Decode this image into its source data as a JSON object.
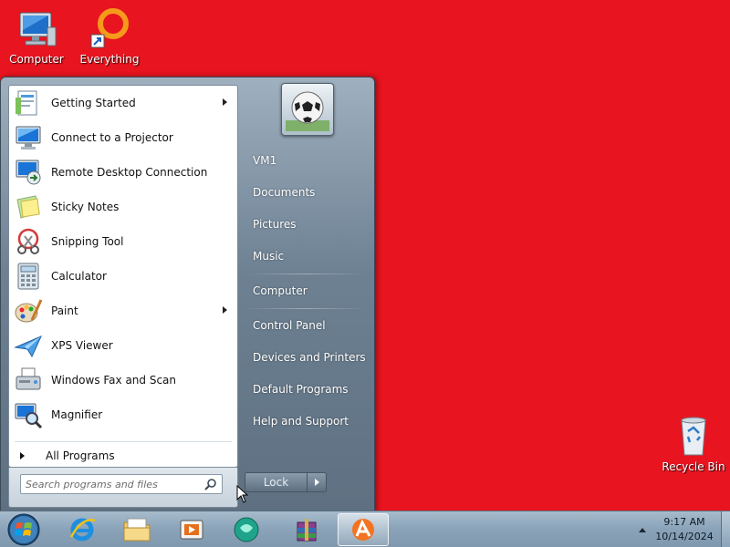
{
  "desktop": {
    "background_color": "#e8141f",
    "icons": [
      {
        "label": "Computer",
        "icon": "computer-icon"
      },
      {
        "label": "Everything",
        "icon": "everything-icon"
      },
      {
        "label": "Recycle Bin",
        "icon": "recycle-bin-icon"
      }
    ]
  },
  "start_menu": {
    "programs": [
      {
        "label": "Getting Started",
        "icon": "getting-started-icon",
        "has_submenu": true
      },
      {
        "label": "Connect to a Projector",
        "icon": "projector-icon",
        "has_submenu": false
      },
      {
        "label": "Remote Desktop Connection",
        "icon": "remote-desktop-icon",
        "has_submenu": false
      },
      {
        "label": "Sticky Notes",
        "icon": "sticky-notes-icon",
        "has_submenu": false
      },
      {
        "label": "Snipping Tool",
        "icon": "snipping-tool-icon",
        "has_submenu": false
      },
      {
        "label": "Calculator",
        "icon": "calculator-icon",
        "has_submenu": false
      },
      {
        "label": "Paint",
        "icon": "paint-icon",
        "has_submenu": true
      },
      {
        "label": "XPS Viewer",
        "icon": "xps-viewer-icon",
        "has_submenu": false
      },
      {
        "label": "Windows Fax and Scan",
        "icon": "fax-scan-icon",
        "has_submenu": false
      },
      {
        "label": "Magnifier",
        "icon": "magnifier-icon",
        "has_submenu": false
      }
    ],
    "all_programs_label": "All Programs",
    "search_placeholder": "Search programs and files",
    "right_items": [
      "VM1",
      "Documents",
      "Pictures",
      "Music",
      "Computer",
      "Control Panel",
      "Devices and Printers",
      "Default Programs",
      "Help and Support"
    ],
    "lock_label": "Lock"
  },
  "taskbar": {
    "pinned": [
      {
        "name": "internet-explorer-icon"
      },
      {
        "name": "file-explorer-icon"
      },
      {
        "name": "media-player-icon"
      },
      {
        "name": "teal-app-icon"
      },
      {
        "name": "winrar-icon"
      },
      {
        "name": "avast-icon",
        "active": true
      }
    ],
    "time": "9:17 AM",
    "date": "10/14/2024"
  }
}
